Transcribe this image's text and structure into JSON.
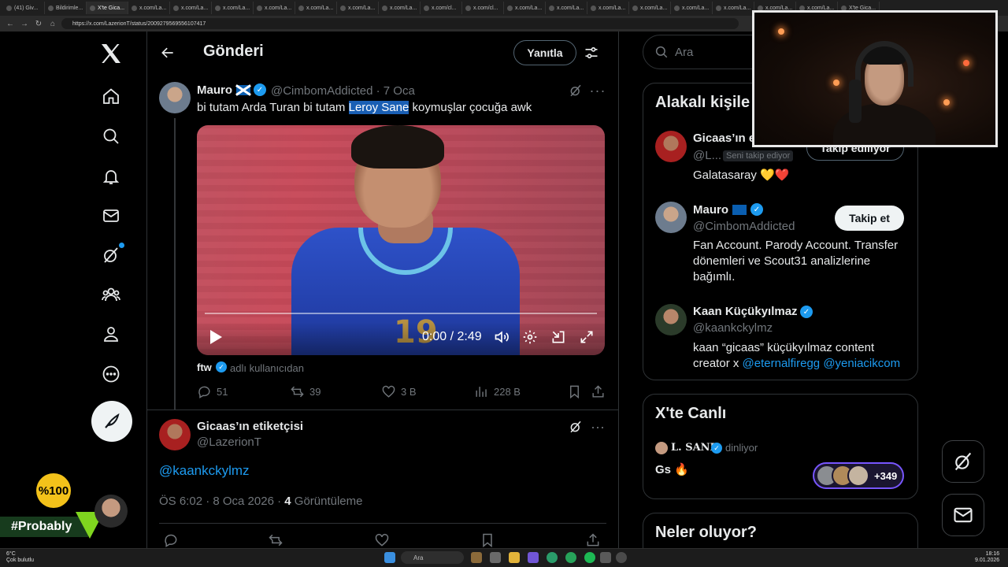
{
  "browser": {
    "tabs": [
      "(41) Giv...",
      "Bildirimle...",
      "X'te Gica...",
      "x.com/La...",
      "x.com/La...",
      "x.com/La...",
      "x.com/La...",
      "x.com/La...",
      "x.com/La...",
      "x.com/La...",
      "x.com/cl...",
      "x.com/cl...",
      "x.com/La...",
      "x.com/La...",
      "x.com/La...",
      "x.com/La...",
      "x.com/La...",
      "x.com/La...",
      "x.com/La...",
      "x.com/La...",
      "X'te Gica..."
    ],
    "url": "https://x.com/LazerionT/status/2009279569556107417"
  },
  "nav": {
    "items": [
      "x-logo",
      "home-icon",
      "explore-icon",
      "notifications-icon",
      "messages-icon",
      "grok-icon",
      "communities-icon",
      "profile-icon",
      "more-icon",
      "post-icon"
    ]
  },
  "header": {
    "title": "Gönderi",
    "reply_label": "Yanıtla"
  },
  "quoted_post": {
    "name": "Mauro",
    "handle": "@CimbomAddicted · 7 Oca",
    "text_before": "bi tutam Arda Turan bi tutam ",
    "text_highlight": "Leroy Sane",
    "text_after": " koymuşlar çocuğa awk",
    "video_time": "0:00 / 2:49",
    "jersey_number": "19",
    "source_name": "ftw",
    "source_text": "adlı kullanıcıdan",
    "replies": "51",
    "reposts": "39",
    "likes": "3 B",
    "views": "228 B"
  },
  "reply_post": {
    "name": "Gicaas’ın etiketçisi",
    "handle": "@LazerionT",
    "text": "@kaankckylmz",
    "time": "ÖS 6:02 · 8 Oca 2026 · ",
    "views_count": "4",
    "views_label": " Görüntüleme"
  },
  "sidebar": {
    "search_placeholder": "Ara",
    "related_title": "Alakalı kişile",
    "users": [
      {
        "name": "Gicaas’ın e",
        "handle": "@L...",
        "follows_you": "Seni takip ediyor",
        "button": "Takip ediliyor",
        "bio": "Galatasaray 💛❤️"
      },
      {
        "name": "Mauro",
        "handle": "@CimbomAddicted",
        "button": "Takip et",
        "bio": "Fan Account. Parody Account. Transfer dönemleri ve Scout31 analizlerine bağımlı."
      },
      {
        "name": "Kaan Küçükyılmaz",
        "handle": "@kaankckylmz",
        "bio_text": "kaan “gicaas” küçükyılmaz content creator x ",
        "bio_link1": "@eternalfiregg",
        "bio_link2": "@yeniacikcom"
      }
    ],
    "live_title": "X'te Canlı",
    "live_host": "𝐋. 𝐒𝐀𝐍𝐄",
    "live_status": "dinliyor",
    "live_text": "Gs 🔥",
    "live_count": "+349",
    "trends_title": "Neler oluyor?"
  },
  "overlay": {
    "badge": "%100",
    "banner": "#Probably"
  },
  "taskbar": {
    "weather_temp": "6°C",
    "weather_desc": "Çok bulutlu",
    "search": "Ara",
    "time": "18:16",
    "date": "9.01.2026"
  },
  "colors": {
    "accent": "#1d9bf0",
    "background": "#000000",
    "text": "#e7e9ea",
    "muted": "#71767b",
    "highlight": "#1a5fb4",
    "live_border": "#7856ff"
  }
}
